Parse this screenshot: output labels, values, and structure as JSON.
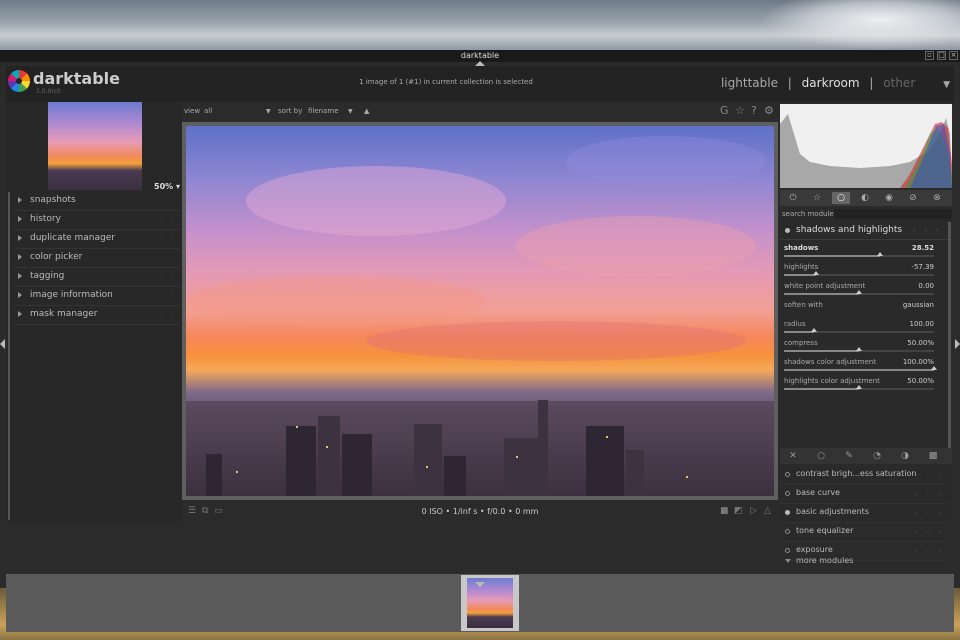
{
  "window": {
    "title": "darktable",
    "controls": [
      "▫",
      "□",
      "×"
    ]
  },
  "header": {
    "app_name": "darktable",
    "version": "1.0.0rc0",
    "collection_status": "1 image of 1 (#1) in current collection is selected",
    "views": [
      "lighttable",
      "|",
      "darkroom",
      "|",
      "other"
    ],
    "active_view": "darkroom"
  },
  "left_panel": {
    "zoom": "50%",
    "modules": [
      "snapshots",
      "history",
      "duplicate manager",
      "color picker",
      "tagging",
      "image information",
      "mask manager"
    ]
  },
  "center_toolbar": {
    "view_label": "view",
    "view_value": "all",
    "sort_label": "sort by",
    "sort_value": "filename",
    "icons": [
      "G",
      "☆",
      "?",
      "⚙"
    ]
  },
  "center_bottom": {
    "exif": "0 ISO • 1/inf s • f/0.0 • 0 mm"
  },
  "right_panel": {
    "search_label": "search module",
    "active_module": "shadows and highlights",
    "params": [
      {
        "label": "shadows",
        "value": "28.52",
        "fraction": 0.64,
        "bold": true
      },
      {
        "label": "highlights",
        "value": "-57.39",
        "fraction": 0.21,
        "bold": false
      },
      {
        "label": "white point adjustment",
        "value": "0.00",
        "fraction": 0.5,
        "bold": false
      },
      {
        "label": "soften with",
        "value": "gaussian",
        "fraction": null,
        "bold": false
      },
      {
        "label": "radius",
        "value": "100.00",
        "fraction": 0.2,
        "bold": false
      },
      {
        "label": "compress",
        "value": "50.00%",
        "fraction": 0.5,
        "bold": false
      },
      {
        "label": "shadows color adjustment",
        "value": "100.00%",
        "fraction": 1.0,
        "bold": false
      },
      {
        "label": "highlights color adjustment",
        "value": "50.00%",
        "fraction": 0.5,
        "bold": false
      }
    ],
    "modules": [
      {
        "label": "contrast brigh...ess saturation",
        "on": false
      },
      {
        "label": "base curve",
        "on": false
      },
      {
        "label": "basic adjustments",
        "on": true
      },
      {
        "label": "tone equalizer",
        "on": false
      },
      {
        "label": "exposure",
        "on": false
      }
    ],
    "more_modules": "more modules"
  }
}
